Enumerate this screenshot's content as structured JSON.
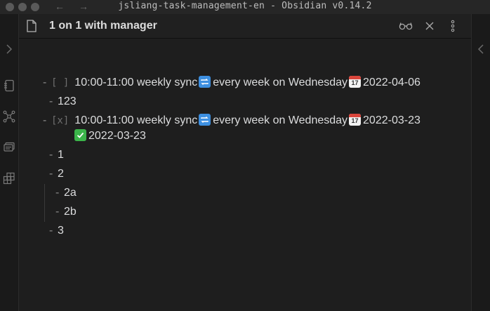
{
  "window": {
    "title": "jsliang-task-management-en - Obsidian v0.14.2"
  },
  "nav": {
    "back_glyph": "←",
    "forward_glyph": "→"
  },
  "pane": {
    "title": "1 on 1 with manager"
  },
  "ribbon": {
    "left_icons": [
      "expand-left-icon",
      "document-icon",
      "graph-view-icon",
      "slides-icon",
      "grid-view-icon"
    ],
    "right_icons": [
      "expand-right-icon"
    ]
  },
  "header_actions": [
    "reading-view-icon",
    "close-icon",
    "more-options-icon"
  ],
  "content": {
    "task1": {
      "checkbox": "[ ]",
      "text_before": "10:00-11:00 weekly sync",
      "recurrence": "every week on Wednesday",
      "due_date": "2022-04-06"
    },
    "item_123": "123",
    "task2": {
      "checkbox": "[x]",
      "text_before": "10:00-11:00 weekly sync",
      "recurrence": "every week on Wednesday",
      "due_date": "2022-03-23",
      "done_date": "2022-03-23"
    },
    "item_1": "1",
    "item_2": "2",
    "item_2a": "2a",
    "item_2b": "2b",
    "item_3": "3",
    "dash": "-",
    "calendar_day": "17"
  },
  "colors": {
    "background": "#1e1e1e",
    "ribbon": "#1a1a1a",
    "text": "#dcddde",
    "muted": "#8a8a8a",
    "repeat_emoji": "#3d8fe0",
    "check_emoji": "#3bb54a",
    "calendar_red": "#d9453b"
  }
}
